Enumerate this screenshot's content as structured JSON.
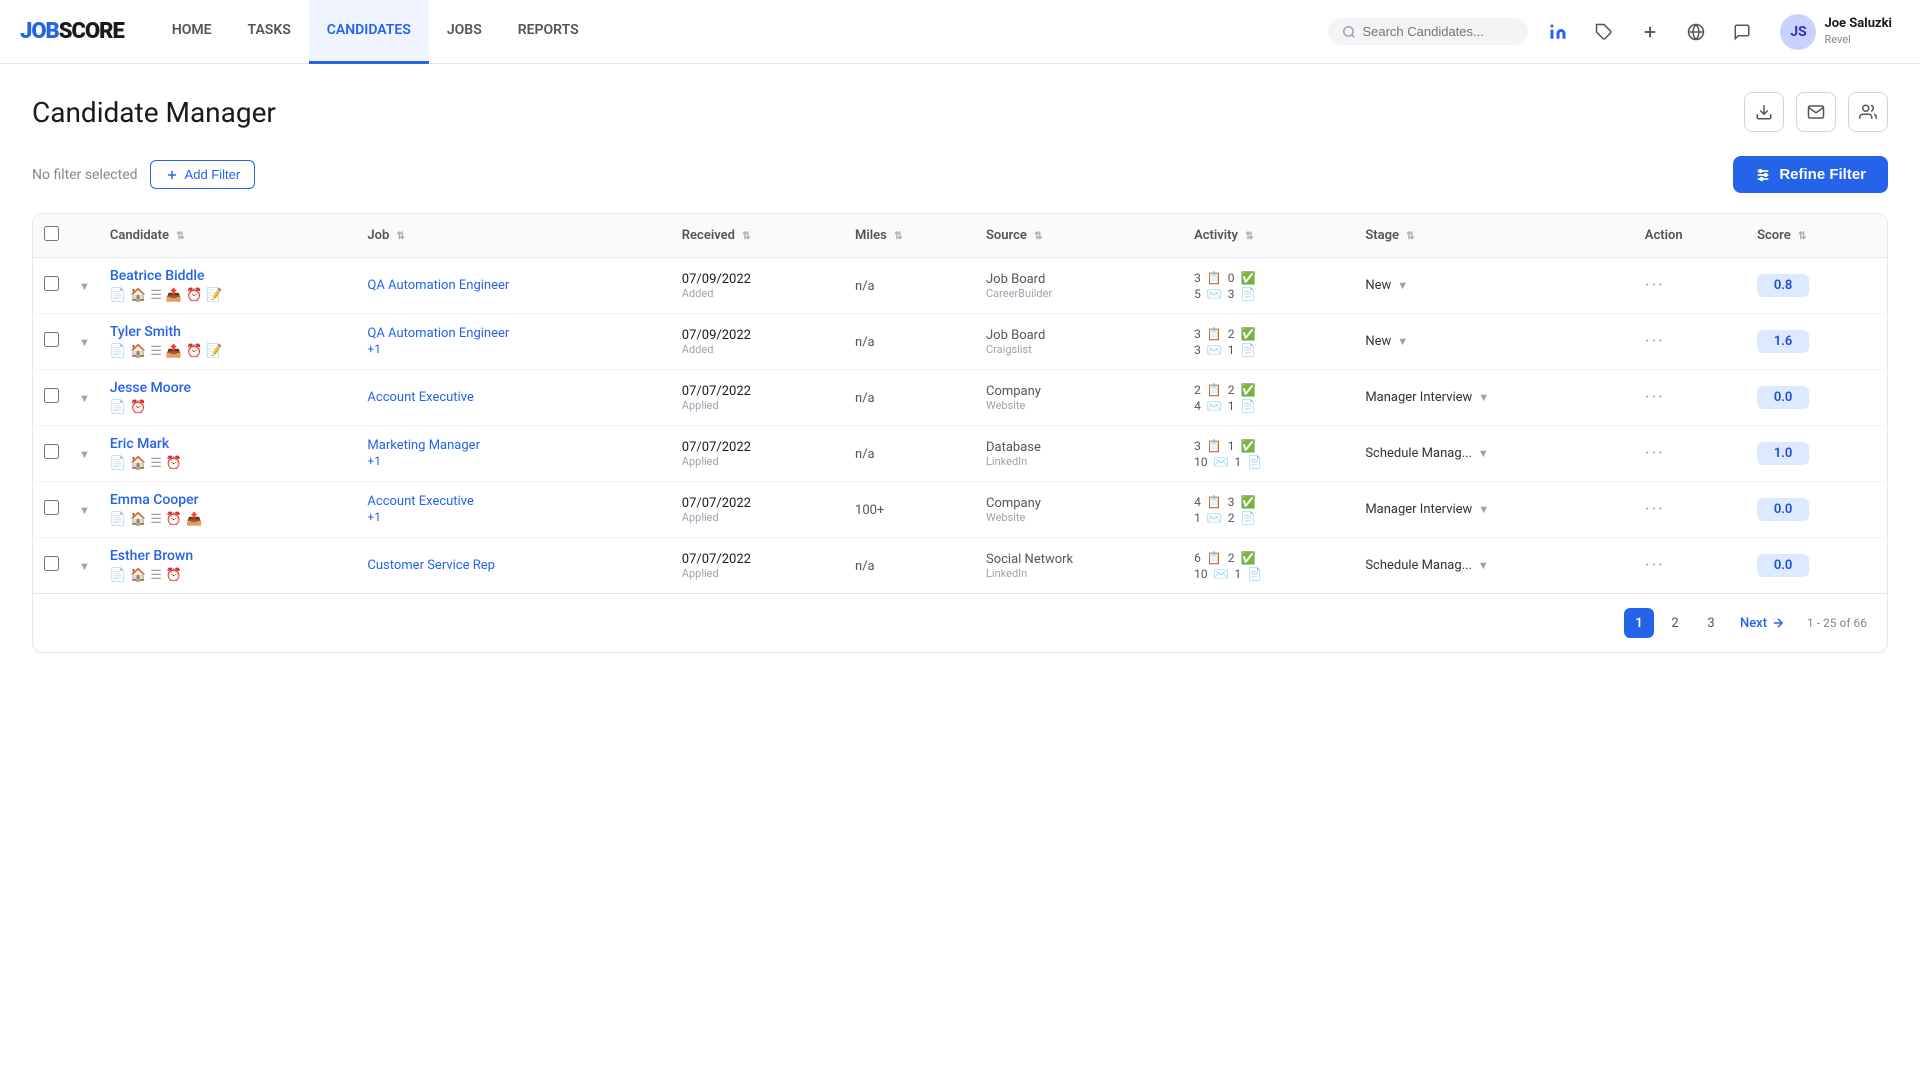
{
  "brand": {
    "logo_part1": "JOB",
    "logo_part2": "SCORE"
  },
  "nav": {
    "links": [
      {
        "id": "home",
        "label": "HOME",
        "active": false
      },
      {
        "id": "tasks",
        "label": "TASKS",
        "active": false
      },
      {
        "id": "candidates",
        "label": "CANDIDATES",
        "active": true
      },
      {
        "id": "jobs",
        "label": "JOBS",
        "active": false
      },
      {
        "id": "reports",
        "label": "REPORTS",
        "active": false
      }
    ],
    "search_placeholder": "Search Candidates...",
    "user": {
      "name": "Joe Saluzki",
      "company": "Revel"
    }
  },
  "page": {
    "title": "Candidate Manager",
    "filter_status": "No filter selected",
    "add_filter_label": "Add Filter",
    "refine_filter_label": "Refine Filter"
  },
  "table": {
    "columns": [
      {
        "id": "candidate",
        "label": "Candidate"
      },
      {
        "id": "job",
        "label": "Job"
      },
      {
        "id": "received",
        "label": "Received"
      },
      {
        "id": "miles",
        "label": "Miles"
      },
      {
        "id": "source",
        "label": "Source"
      },
      {
        "id": "activity",
        "label": "Activity"
      },
      {
        "id": "stage",
        "label": "Stage"
      },
      {
        "id": "action",
        "label": "Action"
      },
      {
        "id": "score",
        "label": "Score"
      }
    ],
    "rows": [
      {
        "id": 1,
        "name": "Beatrice Biddle",
        "job": "QA Automation Engineer",
        "job_extra": "",
        "received_date": "07/09/2022",
        "received_sub": "Added",
        "miles": "n/a",
        "source_main": "Job Board",
        "source_sub": "CareerBuilder",
        "activity_r1_num1": "3",
        "activity_r1_num2": "0",
        "activity_r1_num3": "5",
        "activity_r1_num4": "3",
        "stage": "New",
        "score": "0.8",
        "score_color": "score-blue"
      },
      {
        "id": 2,
        "name": "Tyler Smith",
        "job": "QA Automation Engineer",
        "job_extra": "+1",
        "received_date": "07/09/2022",
        "received_sub": "Added",
        "miles": "n/a",
        "source_main": "Job Board",
        "source_sub": "Craigslist",
        "activity_r1_num1": "3",
        "activity_r1_num2": "2",
        "activity_r1_num3": "3",
        "activity_r1_num4": "1",
        "stage": "New",
        "score": "1.6",
        "score_color": "score-blue"
      },
      {
        "id": 3,
        "name": "Jesse Moore",
        "job": "Account Executive",
        "job_extra": "",
        "received_date": "07/07/2022",
        "received_sub": "Applied",
        "miles": "n/a",
        "source_main": "Company",
        "source_sub": "Website",
        "activity_r1_num1": "2",
        "activity_r1_num2": "2",
        "activity_r1_num3": "4",
        "activity_r1_num4": "1",
        "stage": "Manager Interview",
        "score": "0.0",
        "score_color": "score-blue"
      },
      {
        "id": 4,
        "name": "Eric Mark",
        "job": "Marketing Manager",
        "job_extra": "+1",
        "received_date": "07/07/2022",
        "received_sub": "Applied",
        "miles": "n/a",
        "source_main": "Database",
        "source_sub": "LinkedIn",
        "activity_r1_num1": "3",
        "activity_r1_num2": "1",
        "activity_r1_num3": "10",
        "activity_r1_num4": "1",
        "stage": "Schedule Manag...",
        "score": "1.0",
        "score_color": "score-blue"
      },
      {
        "id": 5,
        "name": "Emma Cooper",
        "job": "Account Executive",
        "job_extra": "+1",
        "received_date": "07/07/2022",
        "received_sub": "Applied",
        "miles": "100+",
        "source_main": "Company",
        "source_sub": "Website",
        "activity_r1_num1": "4",
        "activity_r1_num2": "3",
        "activity_r1_num3": "1",
        "activity_r1_num4": "2",
        "stage": "Manager Interview",
        "score": "0.0",
        "score_color": "score-blue"
      },
      {
        "id": 6,
        "name": "Esther Brown",
        "job": "Customer Service Rep",
        "job_extra": "",
        "received_date": "07/07/2022",
        "received_sub": "Applied",
        "miles": "n/a",
        "source_main": "Social Network",
        "source_sub": "LinkedIn",
        "activity_r1_num1": "6",
        "activity_r1_num2": "2",
        "activity_r1_num3": "10",
        "activity_r1_num4": "1",
        "stage": "Schedule Manag...",
        "score": "0.0",
        "score_color": "score-blue"
      }
    ]
  },
  "pagination": {
    "pages": [
      "1",
      "2",
      "3"
    ],
    "active_page": "1",
    "next_label": "Next",
    "info": "1 - 25 of 66"
  }
}
